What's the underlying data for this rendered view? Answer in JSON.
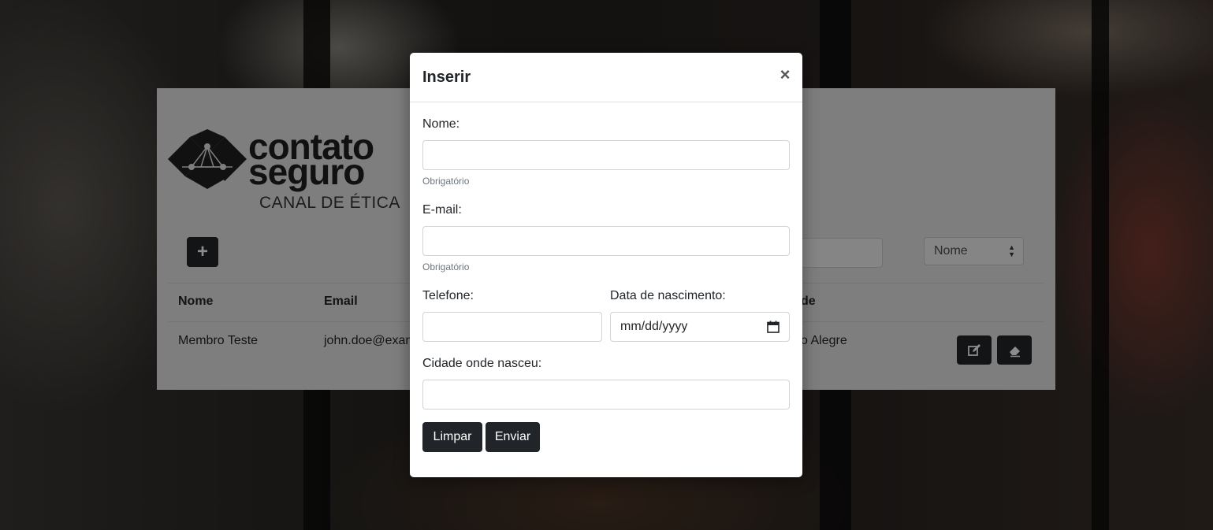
{
  "brand": {
    "name_line1": "contato",
    "name_line2": "seguro",
    "tagline": "CANAL DE ÉTICA"
  },
  "toolbar": {
    "add_label": "+",
    "sort_selected": "Nome"
  },
  "table": {
    "columns": [
      "Nome",
      "Email",
      "de"
    ],
    "rows": [
      {
        "nome": "Membro Teste",
        "email": "john.doe@exan",
        "cidade": "o Alegre"
      }
    ]
  },
  "modal": {
    "title": "Inserir",
    "close": "×",
    "fields": {
      "nome_label": "Nome:",
      "nome_help": "Obrigatório",
      "email_label": "E-mail:",
      "email_help": "Obrigatório",
      "telefone_label": "Telefone:",
      "nascimento_label": "Data de nascimento:",
      "nascimento_placeholder": "mm/dd/yyyy",
      "cidade_label": "Cidade onde nasceu:"
    },
    "buttons": {
      "clear": "Limpar",
      "submit": "Enviar"
    }
  },
  "colors": {
    "dark_button": "#212529",
    "card_bg": "#e6e6e6",
    "help_text": "#6c757d"
  }
}
